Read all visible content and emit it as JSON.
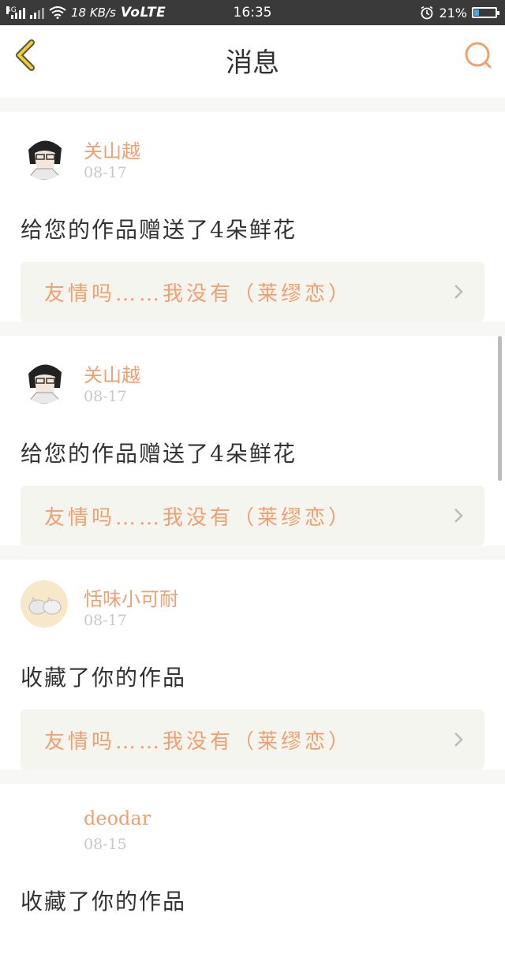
{
  "status_bar": {
    "network_tag": "4G",
    "speed": "18 KB/s",
    "volte": "VoLTE",
    "time": "16:35",
    "battery": "21%",
    "battery_level": 0.21
  },
  "header": {
    "title": "消息"
  },
  "colors": {
    "accent": "#f0a070",
    "text": "#333333",
    "muted": "#c8c8c8",
    "link_bg": "#f5f5ef"
  },
  "messages": [
    {
      "username": "关山越",
      "date": "08-17",
      "text": "给您的作品赠送了4朵鲜花",
      "work_title": "友情吗……我没有（莱缪恋）",
      "avatar": "anime-avatar"
    },
    {
      "username": "关山越",
      "date": "08-17",
      "text": "给您的作品赠送了4朵鲜花",
      "work_title": "友情吗……我没有（莱缪恋）",
      "avatar": "anime-avatar"
    },
    {
      "username": "恬味小可耐",
      "date": "08-17",
      "text": "收藏了你的作品",
      "work_title": "友情吗……我没有（莱缪恋）",
      "avatar": "cat-avatar"
    },
    {
      "username": "deodar",
      "date": "08-15",
      "text": "收藏了你的作品",
      "avatar": "blank-avatar"
    }
  ]
}
